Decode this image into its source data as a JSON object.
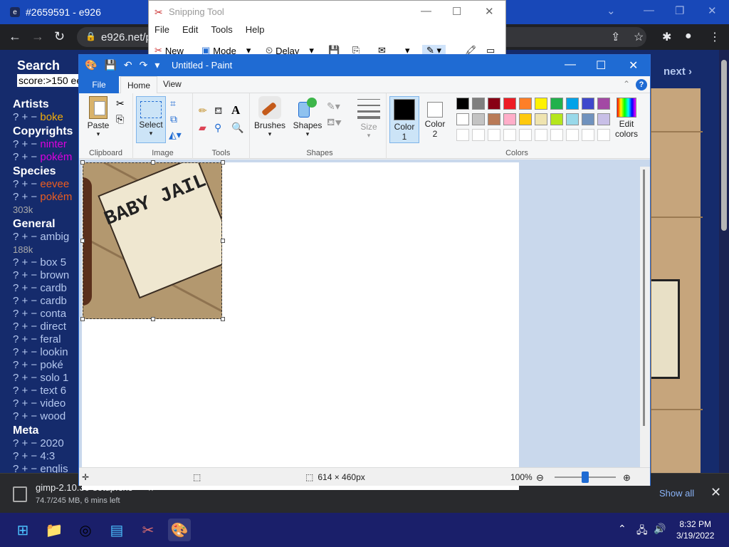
{
  "chrome": {
    "tab_title": "#2659591 - e926",
    "url": "e926.net/p",
    "page": {
      "search_title": "Search",
      "search_value": "score:>150 ee",
      "next_label": "next ›",
      "sections": [
        {
          "heading": "Artists",
          "rows": [
            {
              "text": "boke",
              "cls": "art"
            }
          ]
        },
        {
          "heading": "Copyrights",
          "rows": [
            {
              "text": "ninter",
              "cls": "cpy"
            },
            {
              "text": "pokém",
              "cls": "cpy"
            }
          ]
        },
        {
          "heading": "Species",
          "rows": [
            {
              "text": "eevee",
              "cls": "spc"
            },
            {
              "text": "pokém",
              "cls": "spc"
            }
          ],
          "count": "303k"
        },
        {
          "heading": "General",
          "rows": [
            {
              "text": "ambig",
              "cls": ""
            }
          ],
          "count": "188k",
          "rows2": [
            "box 5",
            "brown",
            "cardb",
            "cardb",
            "conta",
            "direct",
            "feral",
            "lookin",
            "poké",
            "solo 1",
            "text 6",
            "video",
            "wood"
          ]
        },
        {
          "heading": "Meta",
          "rows": [
            {
              "text": "2020",
              "cls": ""
            },
            {
              "text": "4:3",
              "cls": ""
            },
            {
              "text": "englis",
              "cls": ""
            }
          ]
        }
      ]
    },
    "download": {
      "filename": "gimp-2.10.30-setup.exe",
      "meta": "74.7/245 MB, 6 mins left",
      "show_all": "Show all"
    }
  },
  "snipping": {
    "title": "Snipping Tool",
    "menu": [
      "File",
      "Edit",
      "Tools",
      "Help"
    ],
    "toolbar": {
      "new": "New",
      "mode": "Mode",
      "delay": "Delay"
    }
  },
  "paint": {
    "title": "Untitled - Paint",
    "tabs": {
      "file": "File",
      "home": "Home",
      "view": "View"
    },
    "ribbon": {
      "paste": "Paste",
      "clipboard": "Clipboard",
      "select": "Select",
      "image": "Image",
      "tools": "Tools",
      "brushes": "Brushes",
      "shapes_btn": "Shapes",
      "shapes": "Shapes",
      "size": "Size",
      "color1": "Color",
      "color1_num": "1",
      "color2": "Color",
      "color2_num": "2",
      "colors": "Colors",
      "edit_colors_1": "Edit",
      "edit_colors_2": "colors"
    },
    "palette_row1": [
      "#000000",
      "#7f7f7f",
      "#880015",
      "#ed1c24",
      "#ff7f27",
      "#fff200",
      "#22b14c",
      "#00a2e8",
      "#3f48cc",
      "#a349a4"
    ],
    "palette_row2": [
      "#ffffff",
      "#c3c3c3",
      "#b97a57",
      "#ffaec9",
      "#ffc90e",
      "#efe4b0",
      "#b5e61d",
      "#99d9ea",
      "#7092be",
      "#c8bfe7"
    ],
    "image_note": "BABY JAIL",
    "status": {
      "dimensions": "614 × 460px",
      "zoom": "100%"
    }
  },
  "taskbar": {
    "time": "8:32 PM",
    "date": "3/19/2022"
  }
}
